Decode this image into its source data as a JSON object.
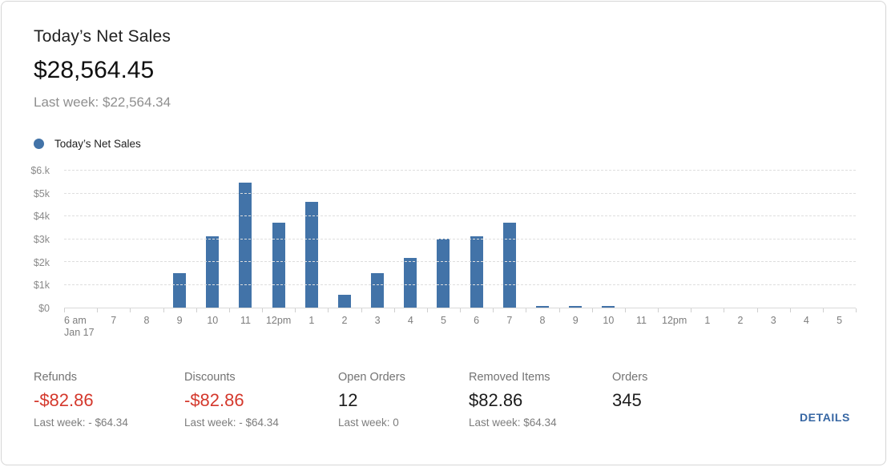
{
  "header": {
    "title": "Today’s Net Sales",
    "value": "$28,564.45",
    "last_week": "Last week: $22,564.34"
  },
  "legend": {
    "label": "Today’s Net Sales",
    "dot_color": "#4273a8"
  },
  "chart_data": {
    "type": "bar",
    "title": "Today’s Net Sales",
    "categories": [
      "6 am",
      "7",
      "8",
      "9",
      "10",
      "11",
      "12pm",
      "1",
      "2",
      "3",
      "4",
      "5",
      "6",
      "7",
      "8",
      "9",
      "10",
      "11",
      "12pm",
      "1",
      "2",
      "3",
      "4",
      "5"
    ],
    "first_category_subline": "Jan 17",
    "values": [
      0,
      0,
      0,
      1500,
      3100,
      5450,
      3700,
      4600,
      550,
      1500,
      2150,
      3000,
      3100,
      3700,
      50,
      50,
      50,
      0,
      0,
      0,
      0,
      0,
      0,
      0
    ],
    "y_tick_labels": [
      "$6.k",
      "$5k",
      "$4k",
      "$3k",
      "$2k",
      "$1k",
      "$0"
    ],
    "ylim": [
      0,
      6000
    ],
    "xlabel": "",
    "ylabel": "",
    "grid": "horizontal-dashed",
    "legend_position": "top-left",
    "bar_color": "#4273a8"
  },
  "stats": [
    {
      "label": "Refunds",
      "value": "-$82.86",
      "value_color": "#d4382c",
      "last_week": "Last week: - $64.34"
    },
    {
      "label": "Discounts",
      "value": "-$82.86",
      "value_color": "#d4382c",
      "last_week": "Last week: - $64.34"
    },
    {
      "label": "Open Orders",
      "value": "12",
      "value_color": "#1c1c1c",
      "last_week": "Last week: 0"
    },
    {
      "label": "Removed Items",
      "value": "$82.86",
      "value_color": "#1c1c1c",
      "last_week": "Last week: $64.34"
    },
    {
      "label": "Orders",
      "value": "345",
      "value_color": "#1c1c1c"
    }
  ],
  "details": {
    "label": "DETAILS",
    "color": "#3666a3"
  },
  "stat_left_offsets": [
    40,
    228,
    420,
    583,
    762
  ]
}
